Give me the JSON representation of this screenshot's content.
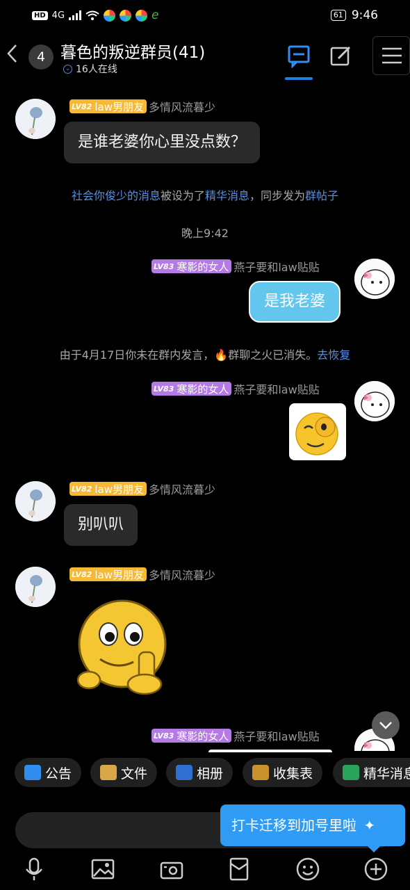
{
  "status_bar": {
    "time": "9:46",
    "battery": "61",
    "network": "4G",
    "hd": "HD"
  },
  "header": {
    "unread_count": "4",
    "title": "暮色的叛逆群员(41)",
    "online": "16人在线"
  },
  "messages": [
    {
      "type": "text_in",
      "level": "LV82",
      "badge": "law男朋友",
      "nickname": "多情风流暮少",
      "text": "是谁老婆你心里没点数？"
    },
    {
      "type": "system_essence",
      "part1": "社会你俊少的消息",
      "part2": "被设为了",
      "part3": "精华消息",
      "part4": "，同步发为",
      "part5": "群帖子"
    },
    {
      "type": "time",
      "text": "晚上9:42"
    },
    {
      "type": "text_out",
      "level": "LV83",
      "badge": "寒影的女人",
      "nickname": "燕子要和law贴贴",
      "text": "是我老婆"
    },
    {
      "type": "system_fire",
      "part1": "由于4月17日你未在群内发言，",
      "part2": "群聊之火已消失。",
      "part3": "去恢复"
    },
    {
      "type": "sticker_out",
      "level": "LV83",
      "badge": "寒影的女人",
      "nickname": "燕子要和law贴贴"
    },
    {
      "type": "text_in",
      "level": "LV82",
      "badge": "law男朋友",
      "nickname": "多情风流暮少",
      "text": "别叭叭"
    },
    {
      "type": "sticker_in",
      "level": "LV82",
      "badge": "law男朋友",
      "nickname": "多情风流暮少"
    },
    {
      "type": "partial_out",
      "level": "LV83",
      "badge": "寒影的女人",
      "nickname": "燕子要和law贴贴"
    }
  ],
  "quick_bar": [
    "公告",
    "文件",
    "相册",
    "收集表",
    "精华消息"
  ],
  "tip": "打卡迁移到加号里啦",
  "colors": {
    "accent": "#1f7fe0",
    "level_gold": "#f5b935",
    "level_purple": "#b57be5",
    "link": "#5a8fe0",
    "bubble_out": "#63c7ed"
  }
}
